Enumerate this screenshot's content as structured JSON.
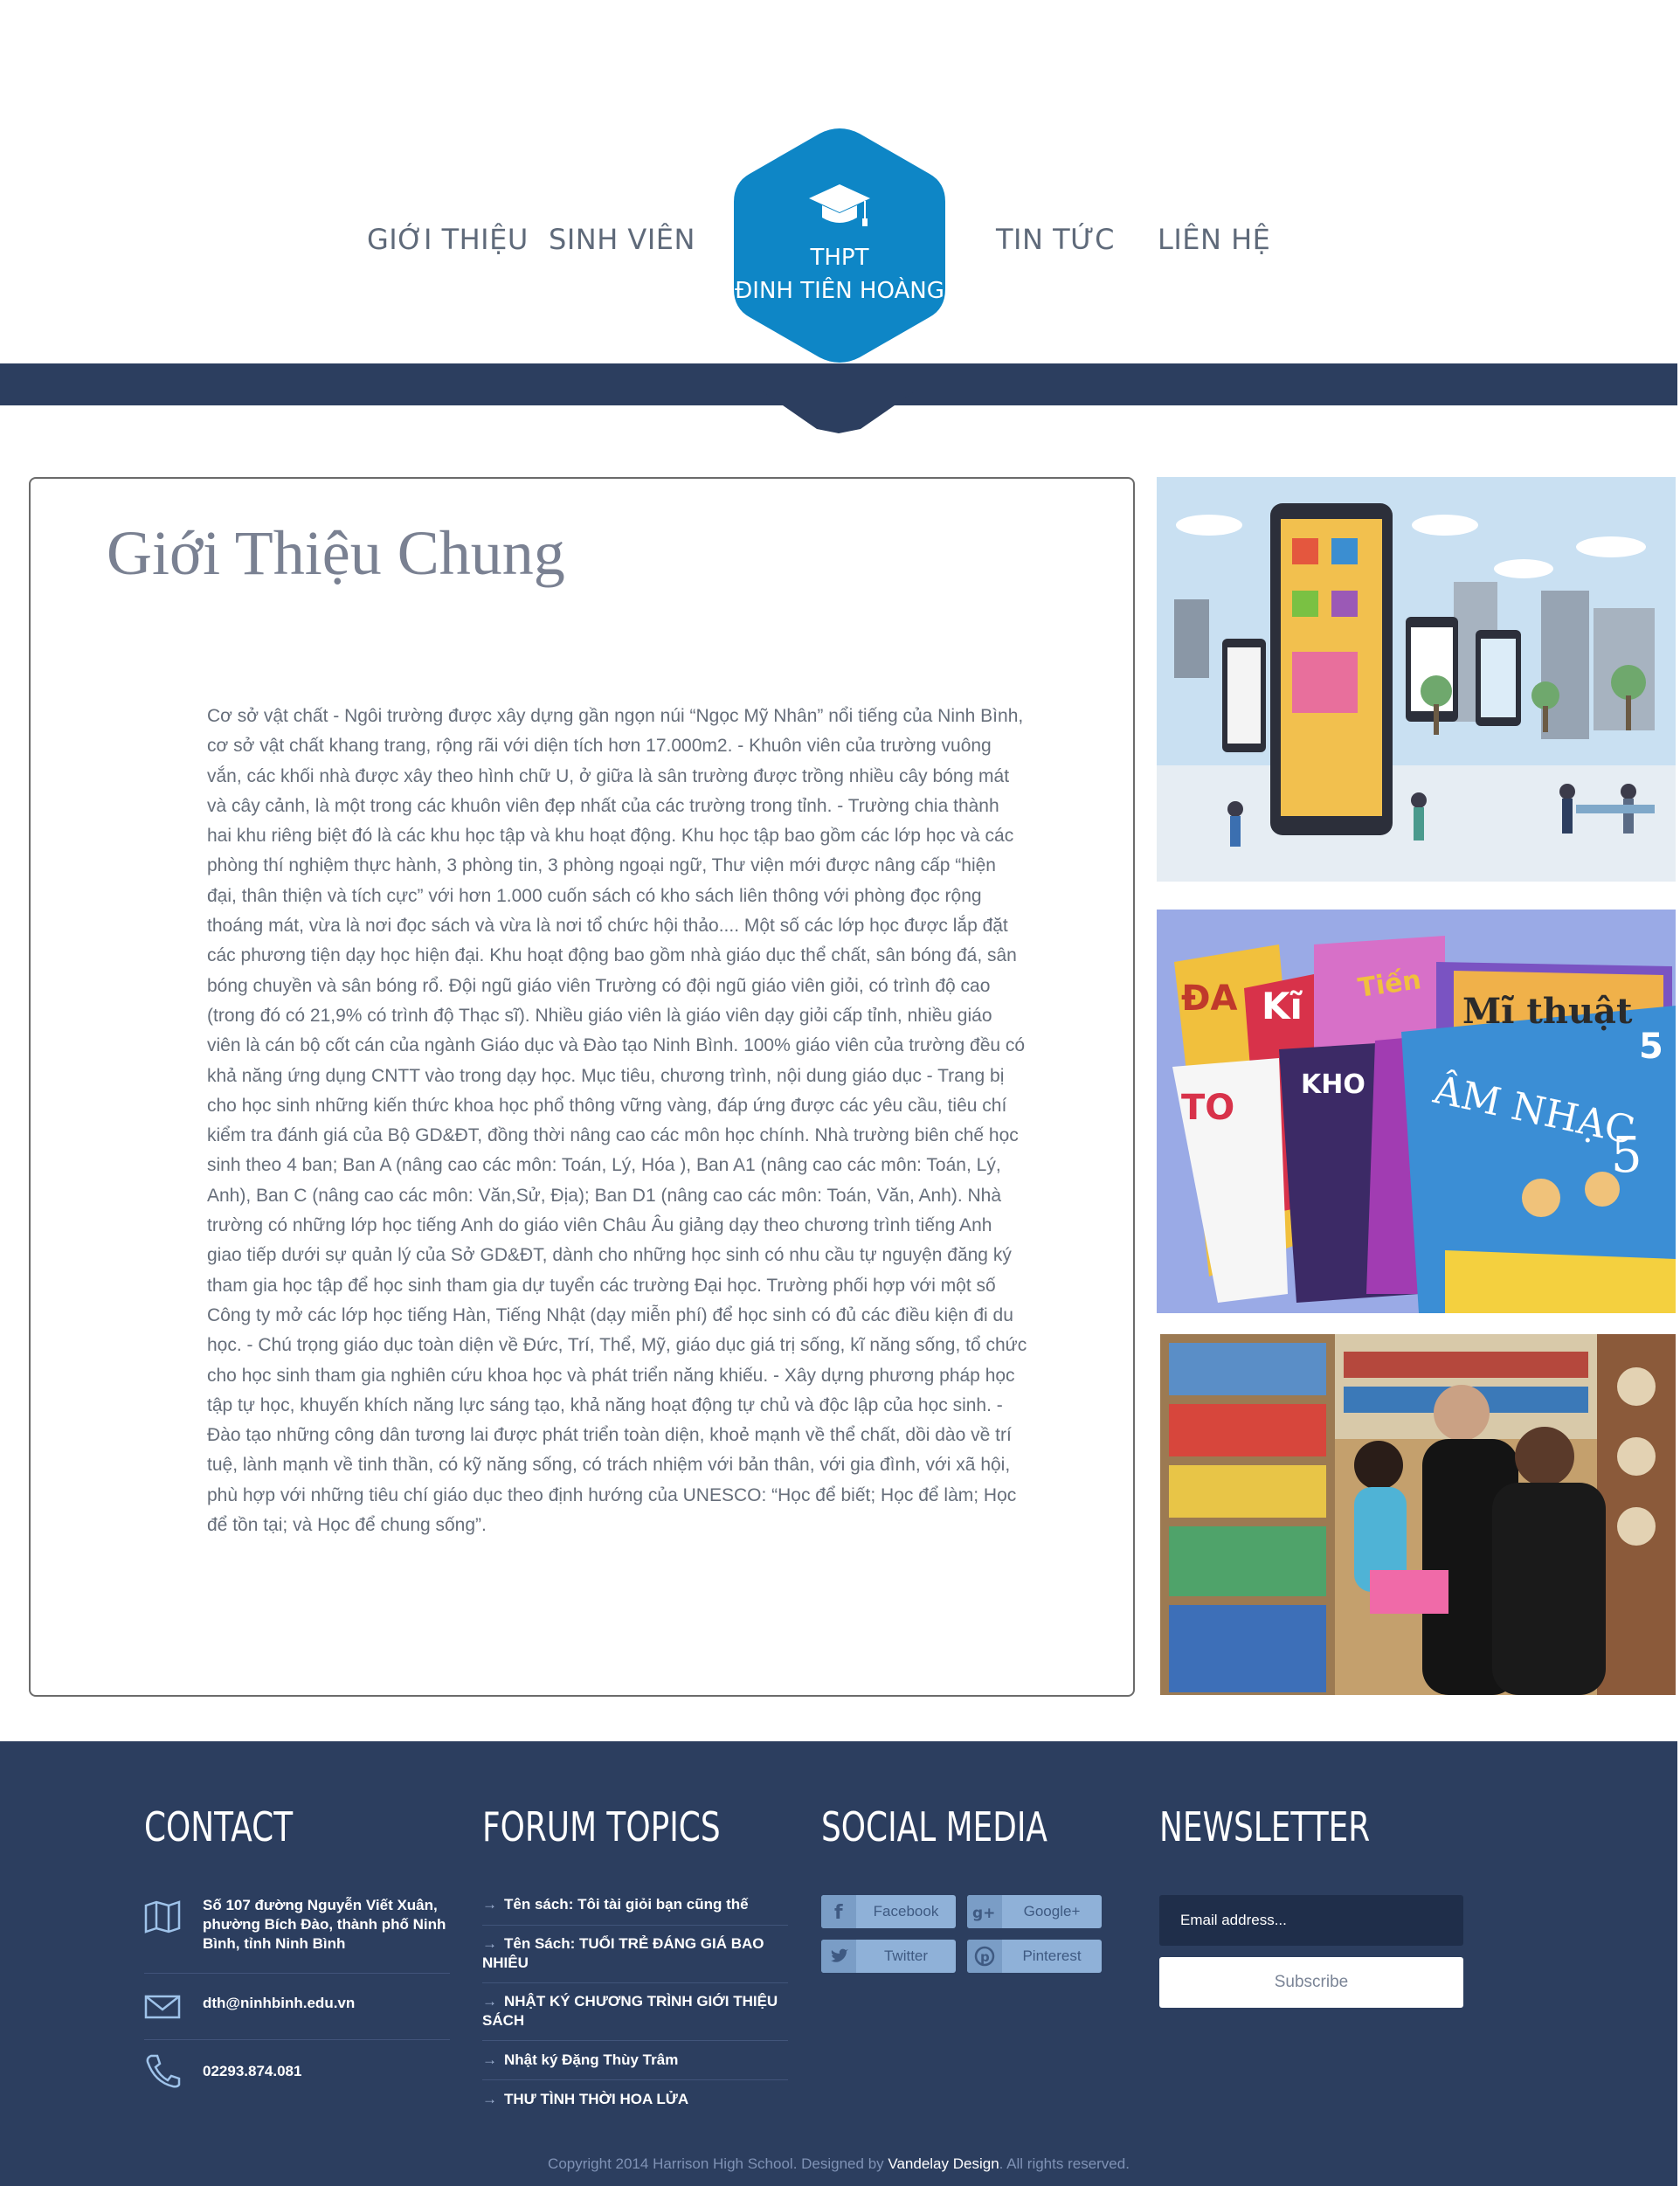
{
  "nav": {
    "left": [
      "GIỚI THIỆU",
      "SINH VIÊN"
    ],
    "right": [
      "TIN TỨC",
      "LIÊN HỆ"
    ],
    "logo_line1": "THPT",
    "logo_line2": "ĐINH TIÊN HOÀNG",
    "logo_icon": "graduation-cap-icon"
  },
  "main": {
    "title": "Giới Thiệu Chung",
    "body": "Cơ sở vật chất - Ngôi trường được xây dựng gần ngọn núi “Ngọc Mỹ Nhân” nổi tiếng của Ninh Bình, cơ sở vật chất khang trang, rộng rãi với diện tích hơn 17.000m2. - Khuôn viên của trường vuông vắn, các khối nhà được xây theo hình chữ U, ở giữa là sân trường được trồng nhiều cây bóng mát và cây cảnh, là một trong các khuôn viên đẹp nhất của các trường trong tỉnh. - Trường chia thành hai khu riêng biệt đó là các khu học tập và khu hoạt động. Khu học tập bao gồm các lớp học và các phòng thí nghiệm thực hành, 3 phòng tin, 3 phòng ngoại ngữ, Thư viện mới được nâng cấp “hiện đại, thân thiện và tích cực” với hơn 1.000 cuốn sách có kho sách liên thông với phòng đọc rộng thoáng mát, vừa là nơi đọc sách và vừa là nơi tổ chức hội thảo.... Một số các lớp học được lắp đặt các phương tiện dạy học hiện đại. Khu hoạt động bao gồm nhà giáo dục thể chất, sân bóng đá, sân bóng chuyền và sân bóng rổ. Đội ngũ giáo viên Trường có đội ngũ giáo viên giỏi, có trình độ cao (trong đó có 21,9% có trình độ Thạc sĩ). Nhiều giáo viên là giáo viên dạy giỏi cấp tỉnh, nhiều giáo viên là cán bộ cốt cán của ngành Giáo dục và Đào tạo Ninh Bình. 100% giáo viên của trường đều có khả năng ứng dụng CNTT vào trong dạy học. Mục tiêu, chương trình, nội dung giáo dục - Trang bị cho học sinh những kiến thức khoa học phổ thông vững vàng, đáp ứng được các yêu cầu, tiêu chí kiểm tra đánh giá của Bộ GD&ĐT, đồng thời nâng cao các môn học chính. Nhà trường biên chế học sinh theo 4 ban; Ban A (nâng cao các môn: Toán, Lý, Hóa ), Ban A1 (nâng cao các môn: Toán, Lý, Anh), Ban C (nâng cao các môn: Văn,Sử, Địa); Ban D1 (nâng cao các môn: Toán, Văn, Anh). Nhà trường có những lớp học tiếng Anh do giáo viên Châu Âu giảng dạy theo chương trình tiếng Anh giao tiếp dưới sự quản lý của Sở GD&ĐT, dành cho những học sinh có nhu cầu tự nguyện đăng ký tham gia học tập để học sinh tham gia dự tuyển các trường Đại học. Trường phối hợp với một số Công ty mở các lớp học tiếng Hàn, Tiếng Nhật (dạy miễn phí) để học sinh có đủ các điều kiện đi du học. - Chú trọng giáo dục toàn diện về Đức, Trí, Thể, Mỹ, giáo dục giá trị sống, kĩ năng sống, tổ chức cho học sinh tham gia nghiên cứu khoa học và phát triển năng khiếu. - Xây dựng phương pháp học tập tự học, khuyến khích năng lực sáng tạo, khả năng hoạt động tự chủ và độc lập của học sinh. - Đào tạo những công dân tương lai được phát triển toàn diện, khoẻ mạnh về thể chất, dồi dào về trí tuệ, lành mạnh về tinh thần, có kỹ năng sống, có trách nhiệm với bản thân, với gia đình, với xã hội, phù hợp với những tiêu chí giáo dục theo định hướng của UNESCO: “Học để biết; Học để làm; Học để tồn tại; và Học để chung sống”."
  },
  "sidebar_images": {
    "books": {
      "title1": "Tiến",
      "title2": "Mĩ thuật",
      "title3": "ÂM NHẠC",
      "grade": "5",
      "short1": "ĐA",
      "short2": "Kĩ",
      "short3": "TO",
      "short4": "KHO"
    }
  },
  "footer": {
    "contact": {
      "heading": "CONTACT",
      "address": "Số 107 đường Nguyễn Viết Xuân, phường Bích Đào, thành phố Ninh Bình, tỉnh Ninh Bình",
      "email": "dth@ninhbinh.edu.vn",
      "phone": "02293.874.081",
      "icons": [
        "map-icon",
        "mail-icon",
        "phone-icon"
      ]
    },
    "forum": {
      "heading": "FORUM TOPICS",
      "topics": [
        "Tên sách: Tôi tài giỏi bạn cũng thế",
        "Tên Sách: TUỔI TRẺ ĐÁNG GIÁ BAO NHIÊU",
        "NHẬT KÝ CHƯƠNG TRÌNH GIỚI THIỆU SÁCH",
        "Nhật ký Đặng Thùy Trâm",
        "THƯ TÌNH THỜI HOA LỬA"
      ]
    },
    "social": {
      "heading": "SOCIAL MEDIA",
      "facebook": "Facebook",
      "google": "Google+",
      "twitter": "Twitter",
      "pinterest": "Pinterest"
    },
    "newsletter": {
      "heading": "NEWSLETTER",
      "placeholder": "Email address...",
      "button": "Subscribe"
    },
    "copyright": {
      "prefix": "Copyright 2014 Harrison High School. Designed by ",
      "credit": "Vandelay Design",
      "suffix": ". All rights reserved."
    }
  },
  "colors": {
    "navy": "#2c3e5f",
    "logo_blue": "#0e86c6",
    "social": "#8fb1d8"
  }
}
